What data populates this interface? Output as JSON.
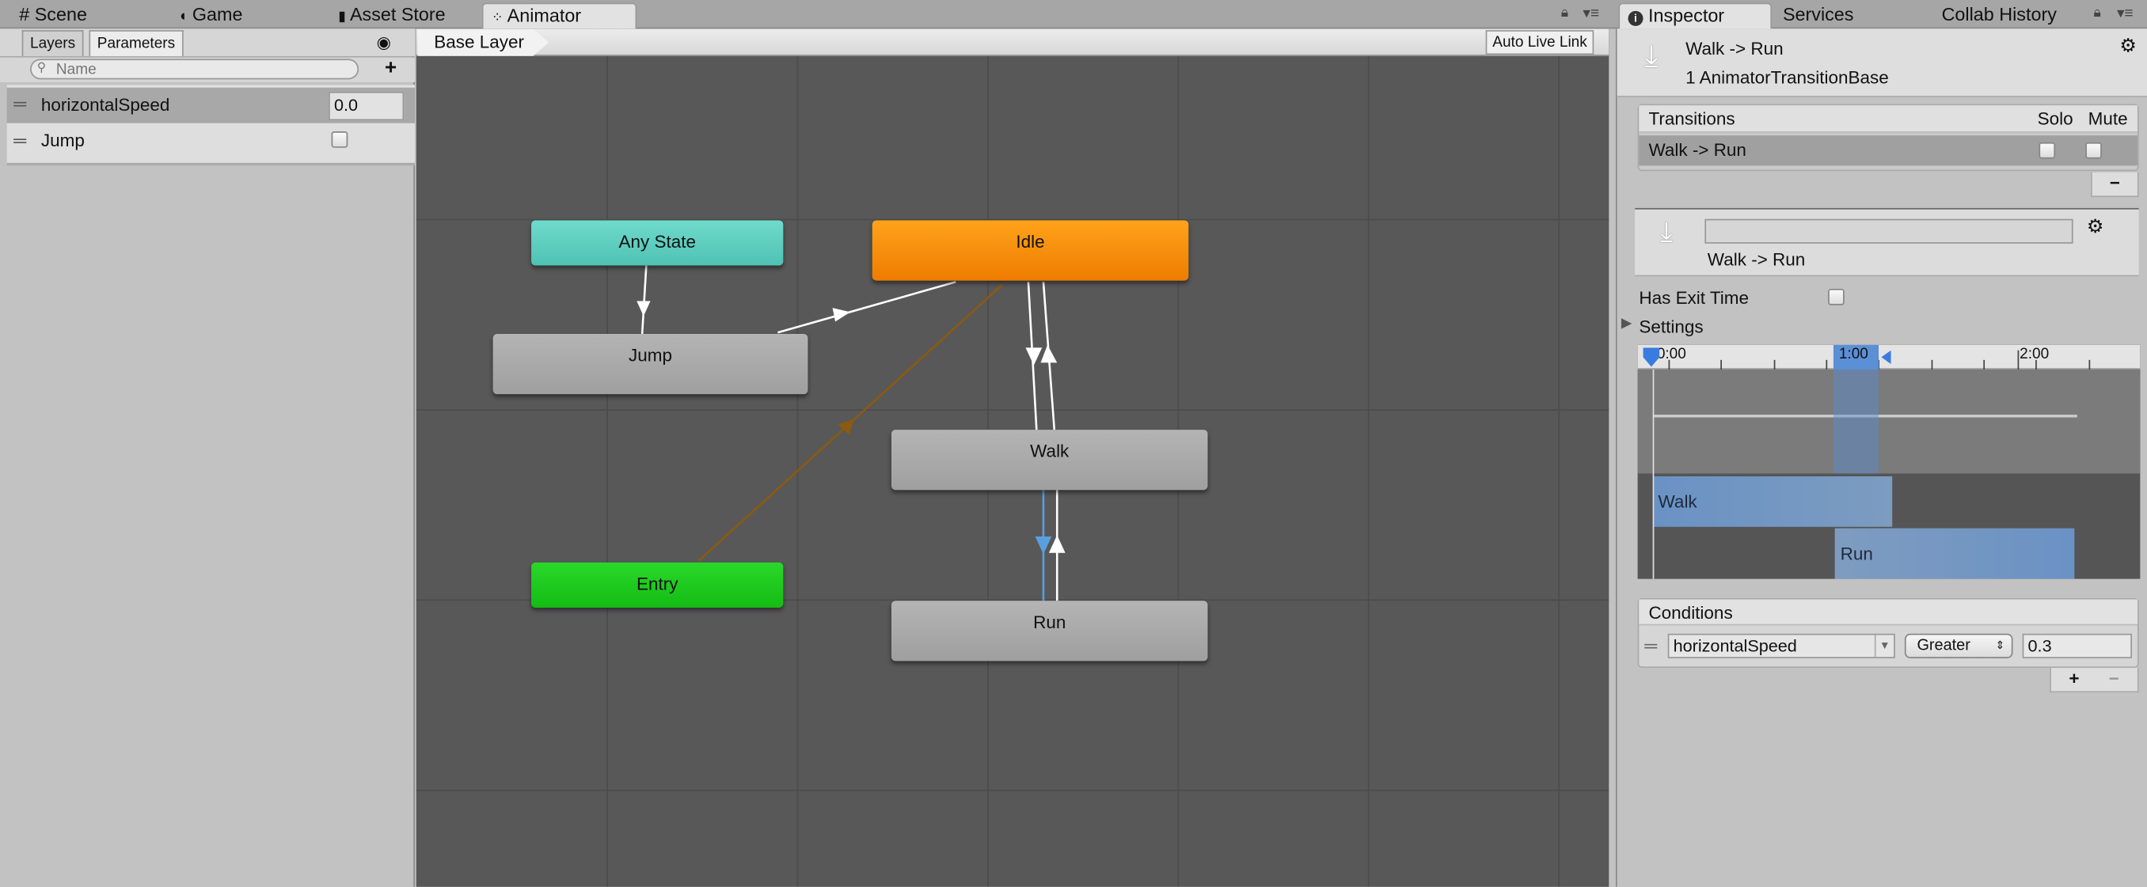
{
  "top_tabs": [
    {
      "label": "Scene",
      "icon": "grid-icon"
    },
    {
      "label": "Game",
      "icon": "pacman-icon"
    },
    {
      "label": "Asset Store",
      "icon": "bag-icon"
    },
    {
      "label": "Animator",
      "icon": "animator-icon",
      "active": true
    }
  ],
  "inspector_tabs": [
    {
      "label": "Inspector",
      "icon": "info-icon",
      "active": true
    },
    {
      "label": "Services"
    },
    {
      "label": "Collab History"
    }
  ],
  "left_panel": {
    "tabs": [
      "Layers",
      "Parameters"
    ],
    "active_tab": "Parameters",
    "search_placeholder": "Name",
    "parameters": [
      {
        "name": "horizontalSpeed",
        "type": "float",
        "value": "0.0",
        "selected": true
      },
      {
        "name": "Jump",
        "type": "trigger",
        "checked": false
      }
    ]
  },
  "graph": {
    "breadcrumb": "Base Layer",
    "auto_live_link": "Auto Live Link",
    "states": {
      "any_state": "Any State",
      "idle": "Idle",
      "jump": "Jump",
      "walk": "Walk",
      "entry": "Entry",
      "run": "Run"
    },
    "colors": {
      "any_state": "#5ecfc0",
      "idle": "#f58a00",
      "entry": "#1ec81e",
      "default": "#a9a9a9",
      "selected_transition": "#5a9ee0",
      "entry_transition": "#8a5a10"
    }
  },
  "inspector": {
    "title": "Walk -> Run",
    "subtitle": "1 AnimatorTransitionBase",
    "transitions": {
      "header": "Transitions",
      "solo": "Solo",
      "mute": "Mute",
      "rows": [
        {
          "label": "Walk -> Run",
          "solo": false,
          "mute": false
        }
      ],
      "remove": "−"
    },
    "transition": {
      "name_value": "",
      "label": "Walk -> Run"
    },
    "has_exit_time": {
      "label": "Has Exit Time",
      "checked": false
    },
    "settings": "Settings",
    "timeline": {
      "ticks": [
        "0:00",
        "1:00",
        "2:00"
      ],
      "clip_a": "Walk",
      "clip_b": "Run"
    },
    "conditions": {
      "header": "Conditions",
      "rows": [
        {
          "parameter": "horizontalSpeed",
          "mode": "Greater",
          "value": "0.3"
        }
      ],
      "add": "+",
      "remove": "−"
    }
  }
}
